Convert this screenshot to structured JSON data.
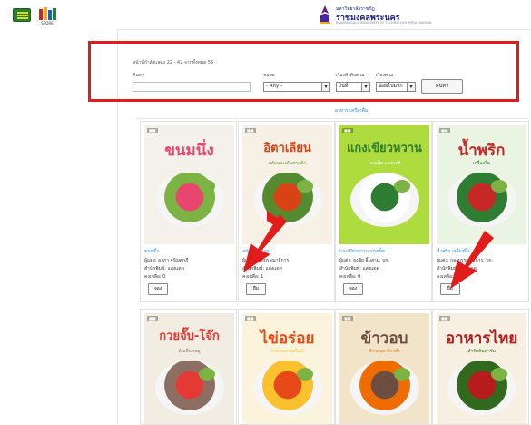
{
  "header": {
    "menu_icon": "hamburger-menu-icon",
    "store_icon": "bookstore-icon",
    "store_caption": "STORE",
    "logo_sub": "มหาวิทยาลัยราชภัฏ",
    "logo_title": "ราชมงคลพระนคร",
    "logo_en": "RAJAMANGALA UNIVERSITY OF TECHNOLOGY PHRA NAKHON"
  },
  "search": {
    "result_count": "หน้าที่กำลังแสดง 22 - 42 จากทั้งหมด 55",
    "keyword_label": "ค้นหา",
    "keyword_value": "",
    "category_label": "หมวด",
    "category_value": "- Any -",
    "sort_by_label": "เรียงลำดับตาม",
    "sort_by_value": "วันที่",
    "order_label": "เรียงตาม",
    "order_value": "น้อยไปมาก",
    "submit_label": "ค้นหา"
  },
  "store_link": "อาหาร-เครื่องดื่ม",
  "books": [
    {
      "cover_title": "ขนมนึ่ง",
      "cover_sub": "",
      "name": "ขนมนึ่ง",
      "author": "ผู้แต่ง: อาภา จรัญศุภฎี",
      "publisher": "สำนักพิมพ์: แสงแดด",
      "queue": "คงเหลือ: 0",
      "action": "จอง",
      "colors": [
        "#f3f1ea",
        "#e8456f",
        "#7cb342"
      ]
    },
    {
      "cover_title": "อิตาเลียน",
      "cover_sub": "สลัดและเส้นพาสต้า",
      "name": "สลัดอิตาเลียน",
      "author": "ผู้แต่ง: กองบรรณาธิการ",
      "publisher": "สำนักพิมพ์: แสงแดด",
      "queue": "คงเหลือ: 1",
      "action": "ยืม",
      "colors": [
        "#f7f0e4",
        "#d84315",
        "#558b2f"
      ]
    },
    {
      "cover_title": "แกงเขียวหวาน",
      "cover_sub": "แกงเผ็ด แกงกะทิ",
      "name": "แกงเขียวหวาน แกงเผ็ด...",
      "author": "ผู้แต่ง: ธงชัย ลิ้มสาม, บก.",
      "publisher": "สำนักพิมพ์: แสงแดด",
      "queue": "คงเหลือ: 0",
      "action": "จอง",
      "colors": [
        "#aedc3e",
        "#2e7d32",
        "#ffffff"
      ]
    },
    {
      "cover_title": "น้ำพริก",
      "cover_sub": "เครื่องจิ้ม",
      "name": "น้ำพริก เครื่องจิ้ม",
      "author": "ผู้แต่ง: กองบรรณาธิการ, บก.",
      "publisher": "สำนักพิมพ์: แสงแดด",
      "queue": "คงเหลือ: 1",
      "action": "ยืม",
      "colors": [
        "#e9f4e2",
        "#c62828",
        "#2e7d32"
      ]
    },
    {
      "cover_title": "กวยจั๊บ-โจ๊ก",
      "cover_sub": "ต้มเลือดหมู",
      "name": "",
      "author": "",
      "publisher": "",
      "queue": "",
      "action": "",
      "colors": [
        "#f2ede3",
        "#e53935",
        "#8d6e63"
      ]
    },
    {
      "cover_title": "ไข่อร่อย",
      "cover_sub": "หลากหลายสไตล์",
      "name": "",
      "author": "",
      "publisher": "",
      "queue": "",
      "action": "",
      "colors": [
        "#fbf3dc",
        "#e64a19",
        "#fbc02d"
      ]
    },
    {
      "cover_title": "ข้าวอบ",
      "cover_sub": "ข้าวคลุก ข้าวยำ",
      "name": "",
      "author": "",
      "publisher": "",
      "queue": "",
      "action": "",
      "colors": [
        "#f1e4c9",
        "#6d4c41",
        "#ef6c00"
      ]
    },
    {
      "cover_title": "อาหารไทย",
      "cover_sub": "สำรับต้นตำรับ",
      "name": "",
      "author": "",
      "publisher": "",
      "queue": "",
      "action": "",
      "colors": [
        "#f6efe2",
        "#b71c1c",
        "#33691e"
      ]
    }
  ],
  "annotations": {
    "highlight_color": "#e21b1b",
    "arrow_color": "#e21b1b"
  }
}
